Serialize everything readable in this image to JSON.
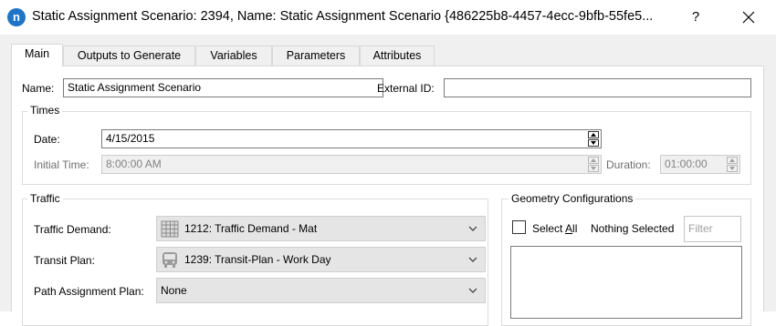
{
  "window": {
    "app_icon_glyph": "n",
    "title": "Static Assignment Scenario: 2394, Name: Static Assignment Scenario  {486225b8-4457-4ecc-9bfb-55fe5...",
    "help_glyph": "?"
  },
  "tabs": [
    {
      "label": "Main",
      "active": true
    },
    {
      "label": "Outputs to Generate",
      "active": false
    },
    {
      "label": "Variables",
      "active": false
    },
    {
      "label": "Parameters",
      "active": false
    },
    {
      "label": "Attributes",
      "active": false
    }
  ],
  "main": {
    "name_label": "Name:",
    "name_value": "Static Assignment Scenario",
    "external_id_label": "External ID:",
    "external_id_value": "",
    "times": {
      "title": "Times",
      "date_label": "Date:",
      "date_value": "4/15/2015",
      "initial_time_label": "Initial Time:",
      "initial_time_value": "8:00:00 AM",
      "duration_label": "Duration:",
      "duration_value": "01:00:00"
    },
    "traffic": {
      "title": "Traffic",
      "demand_label": "Traffic Demand:",
      "demand_value": "1212: Traffic Demand - Mat",
      "demand_icon": "matrix-grid-icon",
      "transit_label": "Transit Plan:",
      "transit_value": "1239: Transit-Plan - Work Day",
      "transit_icon": "bus-icon",
      "path_label": "Path Assignment Plan:",
      "path_value": "None"
    },
    "geometry": {
      "title": "Geometry Configurations",
      "select_all_label": "Select All",
      "nothing_selected": "Nothing Selected",
      "filter_placeholder": "Filter"
    }
  },
  "colors": {
    "accent": "#1f74c6",
    "dialog_bg": "#f0f0f0",
    "panel_bg": "#ffffff",
    "border": "#7a7a7a",
    "disabled_text": "#838383"
  }
}
